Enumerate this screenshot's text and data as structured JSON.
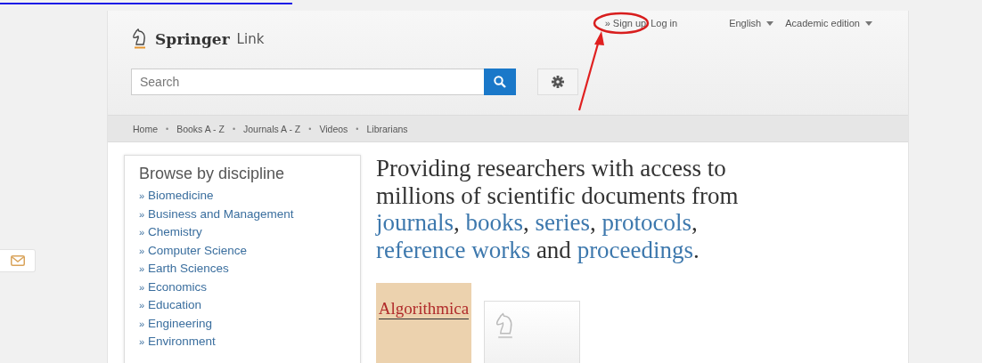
{
  "header": {
    "logo": {
      "brand": "Springer",
      "suffix": "Link"
    },
    "account_links": [
      {
        "label": "» Sign up"
      },
      {
        "label": "Log in"
      }
    ],
    "menus": [
      {
        "label": "English"
      },
      {
        "label": "Academic edition"
      }
    ],
    "search": {
      "placeholder": "Search"
    }
  },
  "nav": [
    "Home",
    "Books A - Z",
    "Journals A - Z",
    "Videos",
    "Librarians"
  ],
  "nav_separator": "•",
  "sidebar": {
    "title": "Browse by discipline",
    "items": [
      "Biomedicine",
      "Business and Management",
      "Chemistry",
      "Computer Science",
      "Earth Sciences",
      "Economics",
      "Education",
      "Engineering",
      "Environment"
    ],
    "bullet": "»"
  },
  "headline": [
    {
      "text": "Providing researchers with access to millions of scientific documents from ",
      "link": false
    },
    {
      "text": "journals",
      "link": true
    },
    {
      "text": ", ",
      "link": false
    },
    {
      "text": "books",
      "link": true
    },
    {
      "text": ", ",
      "link": false
    },
    {
      "text": "series",
      "link": true
    },
    {
      "text": ", ",
      "link": false
    },
    {
      "text": "protocols",
      "link": true
    },
    {
      "text": ", ",
      "link": false
    },
    {
      "text": "reference works",
      "link": true
    },
    {
      "text": " and ",
      "link": false
    },
    {
      "text": "proceedings",
      "link": true
    },
    {
      "text": ".",
      "link": false
    }
  ],
  "covers": [
    {
      "kind": "journal",
      "title": "Algorithmica"
    },
    {
      "kind": "placeholder"
    }
  ],
  "annotation": {
    "highlight_sign_up": true
  }
}
